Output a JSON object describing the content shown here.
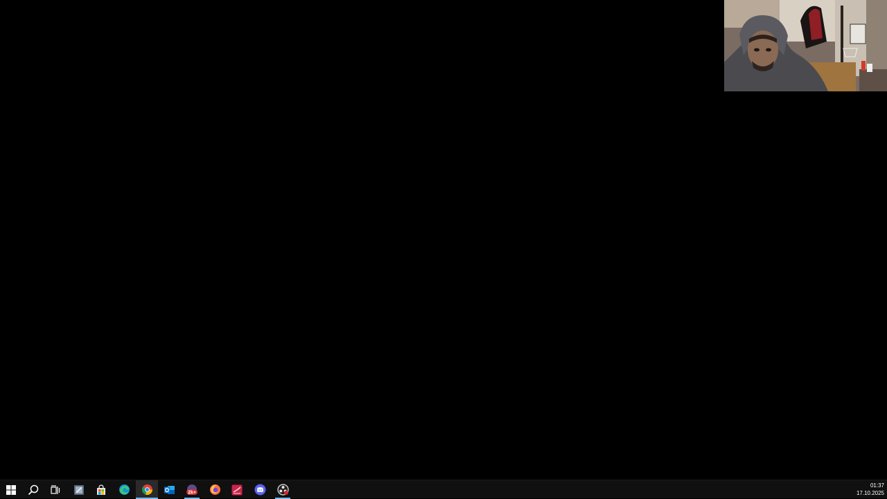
{
  "desktop": {
    "background_color": "#000000"
  },
  "webcam": {
    "description_icon": "webcam-overlay"
  },
  "taskbar": {
    "background_color": "#101010",
    "accent_color": "#76b9ed",
    "icons": [
      {
        "name": "start-button",
        "icon": "windows-logo-icon"
      },
      {
        "name": "search-button",
        "icon": "search-icon"
      },
      {
        "name": "task-view-button",
        "icon": "task-view-icon"
      },
      {
        "name": "taskbar-app-window",
        "icon": "app-window-icon"
      },
      {
        "name": "taskbar-app-store",
        "icon": "store-icon"
      },
      {
        "name": "taskbar-app-edge",
        "icon": "edge-icon"
      },
      {
        "name": "taskbar-app-chrome",
        "icon": "chrome-icon",
        "active": true
      },
      {
        "name": "taskbar-app-outlook",
        "icon": "outlook-icon"
      },
      {
        "name": "taskbar-app-notifications",
        "icon": "badge-app-icon",
        "badge": "2k+"
      },
      {
        "name": "taskbar-app-firefox",
        "icon": "firefox-icon"
      },
      {
        "name": "taskbar-app-red",
        "icon": "red-app-icon"
      },
      {
        "name": "taskbar-app-discord",
        "icon": "discord-icon"
      },
      {
        "name": "taskbar-app-obs",
        "icon": "obs-icon"
      }
    ],
    "clock": {
      "time": "01:37",
      "date": "17.10.2025"
    }
  }
}
